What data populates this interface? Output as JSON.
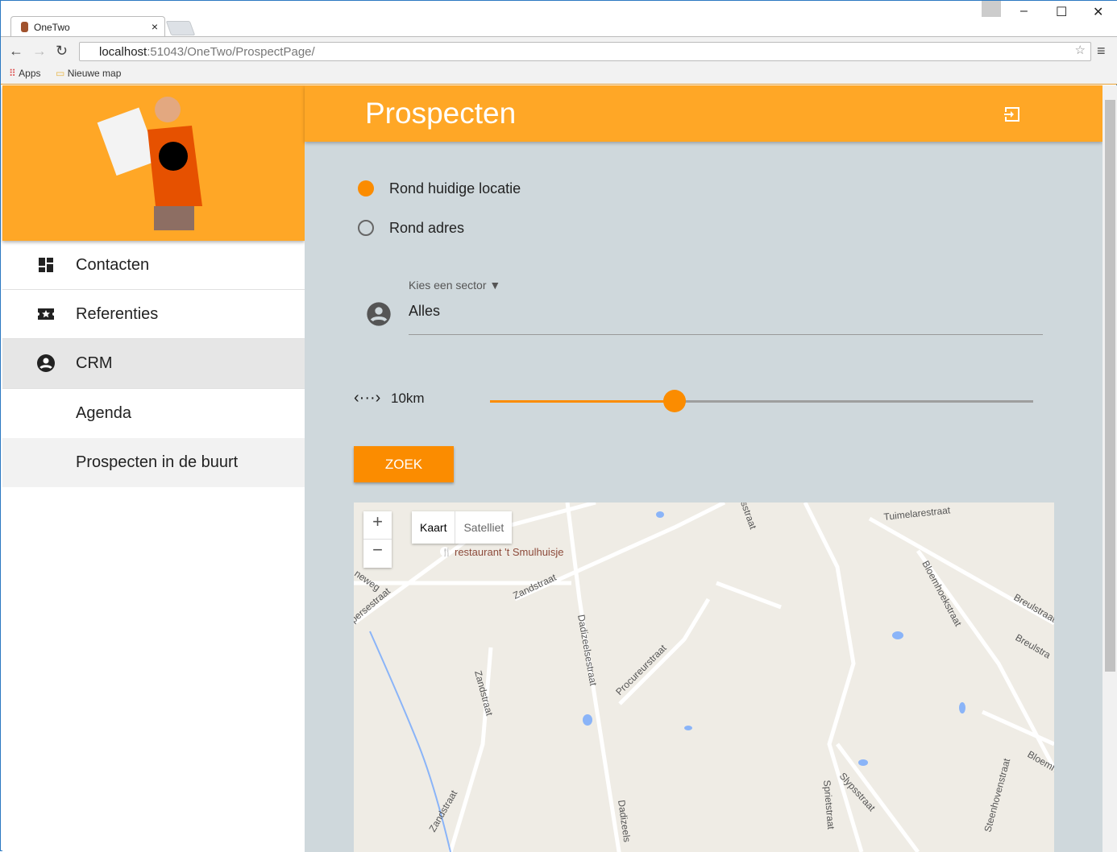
{
  "browser": {
    "tab_title": "OneTwo",
    "url_host": "localhost",
    "url_path": ":51043/OneTwo/ProspectPage/",
    "bookmarks": [
      "Apps",
      "Nieuwe map"
    ]
  },
  "sidebar": {
    "items": [
      {
        "label": "Contacten",
        "icon": "dashboard-icon"
      },
      {
        "label": "Referenties",
        "icon": "ticket-star-icon"
      },
      {
        "label": "CRM",
        "icon": "account-circle-icon"
      },
      {
        "label": "Agenda"
      },
      {
        "label": "Prospecten in de buurt"
      }
    ]
  },
  "header": {
    "title": "Prospecten",
    "action_icon": "exit-icon"
  },
  "form": {
    "radio_current": "Rond huidige locatie",
    "radio_address": "Rond adres",
    "selected_radio": "current",
    "sector_label": "Kies een sector ▼",
    "sector_value": "Alles",
    "distance_label": "10km",
    "distance_fraction": 0.34,
    "search_button": "ZOEK",
    "accent": "#fb8c00"
  },
  "map": {
    "zoom_in": "+",
    "zoom_out": "−",
    "type_map": "Kaart",
    "type_satellite": "Satelliet",
    "poi": "restaurant 't Smulhuisje",
    "streets": [
      "Zandstraat",
      "Dadizeelsestraat",
      "Procureurstraat",
      "Bloemhoekstraat",
      "Tuimelarestraat",
      "Breulstraat",
      "Slypsstraat",
      "Sprietstraat",
      "Steenhovenstraat",
      "persestraat",
      "neweg",
      "Dadizeels",
      "Zandstraat",
      "Zandstraat",
      "Breulstra",
      "Bloemh",
      "sstraat"
    ]
  }
}
